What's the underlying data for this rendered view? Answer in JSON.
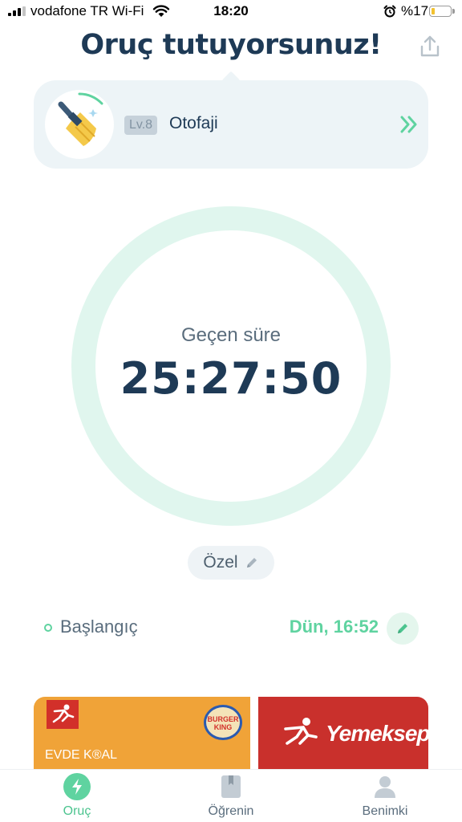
{
  "status_bar": {
    "carrier": "vodafone TR Wi-Fi",
    "time": "18:20",
    "battery_percent": "%17",
    "battery_level": 0.17
  },
  "header": {
    "title": "Oruç tutuyorsunuz!",
    "share_icon": "share-icon"
  },
  "stage": {
    "level": "Lv.8",
    "name": "Otofaji",
    "icon": "broom-icon"
  },
  "timer": {
    "label": "Geçen süre",
    "elapsed": "25:27:50",
    "ring_color": "#e0f6ee"
  },
  "plan": {
    "label": "Özel",
    "icon": "pencil-icon"
  },
  "start": {
    "label": "Başlangıç",
    "value": "Dün, 16:52"
  },
  "promos": [
    {
      "brand": "BURGER KING",
      "text": "EVDE K®AL"
    },
    {
      "brand": "Yemeksepeti"
    }
  ],
  "tabs": [
    {
      "label": "Oruç",
      "icon": "bolt-icon",
      "active": true
    },
    {
      "label": "Öğrenin",
      "icon": "book-icon",
      "active": false
    },
    {
      "label": "Benimki",
      "icon": "user-icon",
      "active": false
    }
  ],
  "colors": {
    "accent": "#5fd3a0",
    "title": "#1e3a56",
    "card": "#edf4f7"
  }
}
